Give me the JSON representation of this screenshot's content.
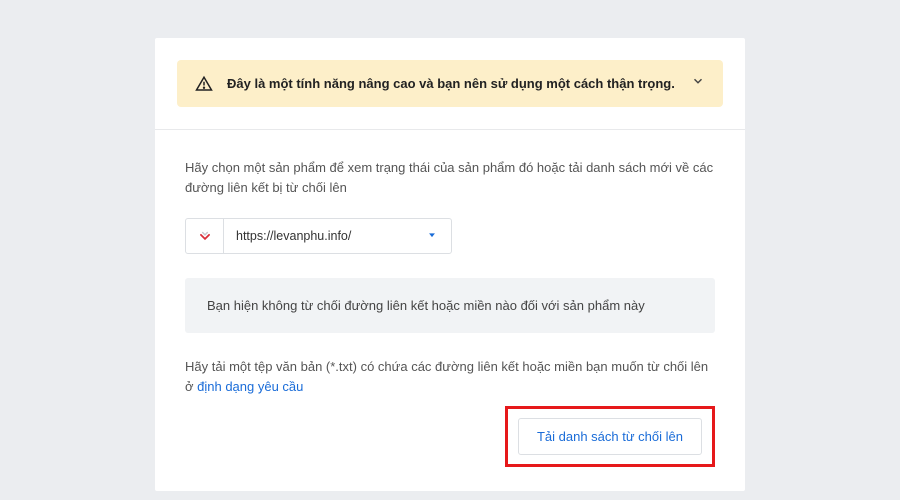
{
  "warning": {
    "text": "Đây là một tính năng nâng cao và bạn nên sử dụng một cách thận trọng."
  },
  "instruction": "Hãy chọn một sản phẩm để xem trạng thái của sản phẩm đó hoặc tải danh sách mới về các đường liên kết bị từ chối lên",
  "dropdown": {
    "selected": "https://levanphu.info/"
  },
  "status": "Bạn hiện không từ chối đường liên kết hoặc miền nào đối với sản phẩm này",
  "upload": {
    "prefix": "Hãy tải một tệp văn bản (*.txt) có chứa các đường liên kết hoặc miền bạn muốn từ chối lên ở ",
    "link": "định dạng yêu cầu",
    "button": "Tải danh sách từ chối lên"
  }
}
